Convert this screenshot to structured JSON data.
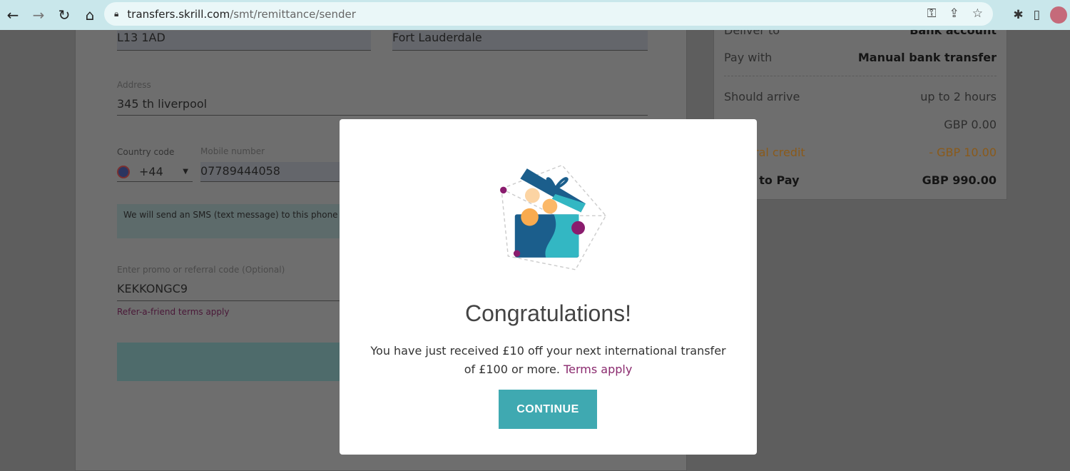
{
  "browser": {
    "url_host": "transfers.skrill.com",
    "url_path": "/smt/remittance/sender"
  },
  "form": {
    "postcode": "L13 1AD",
    "city": "Fort Lauderdale",
    "address_label": "Address",
    "address": "345 th liverpool",
    "country_code_label": "Country code",
    "country_code": "+44",
    "mobile_label": "Mobile number",
    "mobile": "07789444058",
    "sms_notice": "We will send an SMS (text message) to this phone number for verification purposes.",
    "promo_label": "Enter promo or referral code (Optional)",
    "promo": "KEKKONGC9",
    "promo_terms": "Refer-a-friend terms apply"
  },
  "summary": {
    "deliver_label": "Deliver to",
    "deliver_value": "Bank account",
    "pay_label": "Pay with",
    "pay_value": "Manual bank transfer",
    "arrive_label": "Should arrive",
    "arrive_value": "up to 2 hours",
    "fee_value": "GBP 0.00",
    "credit_label": "Referral credit",
    "credit_value": "- GBP 10.00",
    "total_label": "Total to Pay",
    "total_value": "GBP 990.00"
  },
  "modal": {
    "title": "Congratulations!",
    "message": "You have just received £10 off your next international transfer of £100 or more.",
    "terms_link": "Terms apply",
    "continue_label": "CONTINUE",
    "colors": {
      "accent": "#3fa9b1",
      "link": "#8a2a6e"
    }
  }
}
